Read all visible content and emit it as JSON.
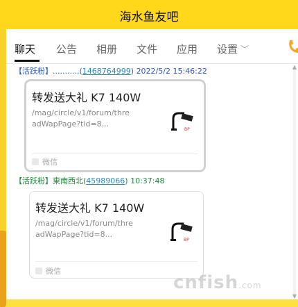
{
  "window": {
    "title": "海水鱼友吧"
  },
  "tabs": [
    {
      "label": "聊天",
      "active": true
    },
    {
      "label": "公告"
    },
    {
      "label": "相册"
    },
    {
      "label": "文件"
    },
    {
      "label": "应用"
    },
    {
      "label": "设置"
    }
  ],
  "messages": [
    {
      "tag": "【活跃粉】",
      "name": "...........",
      "qq": "1468764999",
      "time": "2022/5/2 15:46:22",
      "card": {
        "title": "转发送大礼 K7 140W",
        "url_line1": "/mag/circle/v1/forum/thre",
        "url_line2": "adWapPage?tid=8...",
        "source": "微信"
      }
    },
    {
      "tag": "【活跃粉】",
      "name": "東南西北",
      "qq": "45989066",
      "time": "10:37:48",
      "card": {
        "title": "转发送大礼 K7 140W",
        "url_line1": "/mag/circle/v1/forum/thre",
        "url_line2": "adWapPage?tid=8...",
        "source": "微信"
      }
    }
  ],
  "watermark": {
    "main": "cnfish",
    "suffix": ".com"
  },
  "colors": {
    "titlebar": "#ffd81c",
    "link": "#2a86c6",
    "active_fan_green": "#1f8a3a"
  }
}
